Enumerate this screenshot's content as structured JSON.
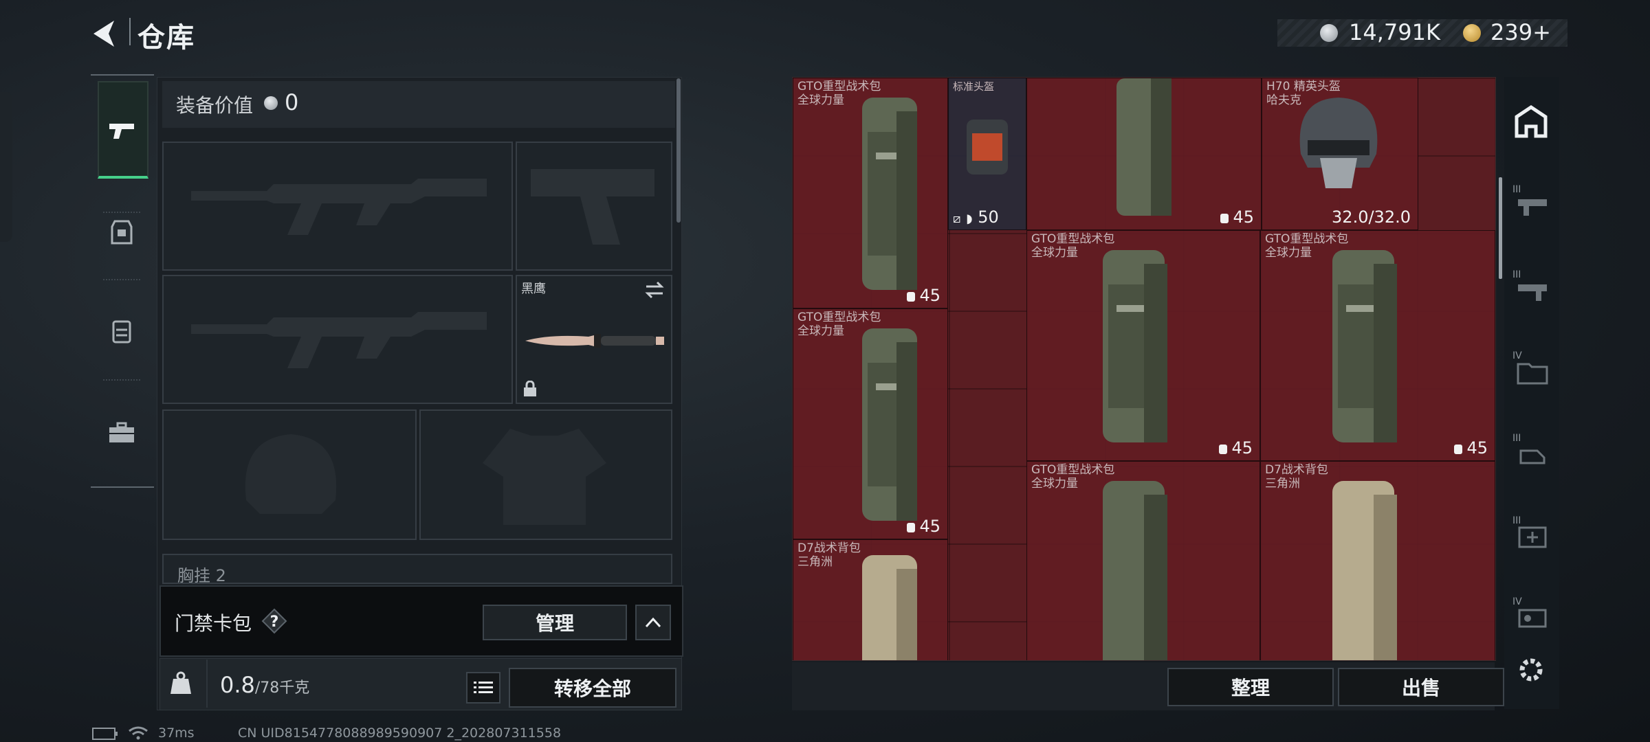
{
  "header": {
    "title": "仓库",
    "currency_silver": "14,791K",
    "currency_gold": "239+"
  },
  "equipment": {
    "title": "装备价值",
    "value": "0",
    "melee_name": "黑鹰",
    "chest_label_partial": "胸挂 2"
  },
  "access_card": {
    "label": "门禁卡包",
    "help": "?",
    "manage_label": "管理"
  },
  "weight": {
    "current": "0.8",
    "max": "/78千克",
    "transfer_all_label": "转移全部"
  },
  "stash": {
    "items": [
      {
        "name": "GTO重型战术包",
        "sub": "全球力量",
        "stat": "45"
      },
      {
        "name": "标准头盔",
        "sub": "",
        "durability": "50"
      },
      {
        "name": "",
        "sub": "",
        "stat": "45"
      },
      {
        "name": "H70 精英头盔",
        "sub": "哈夫克",
        "stat": "32.0/32.0"
      },
      {
        "name": "GTO重型战术包",
        "sub": "全球力量",
        "stat": "45"
      },
      {
        "name": "GTO重型战术包",
        "sub": "全球力量",
        "stat": "45"
      },
      {
        "name": "GTO重型战术包",
        "sub": "全球力量",
        "stat": "45"
      },
      {
        "name": "GTO重型战术包",
        "sub": "全球力量",
        "stat": ""
      },
      {
        "name": "D7战术背包",
        "sub": "三角洲",
        "stat": ""
      },
      {
        "name": "D7战术背包",
        "sub": "三角洲",
        "stat": ""
      }
    ],
    "sort_label": "整理",
    "sell_label": "出售"
  },
  "filters": {
    "tiers": [
      "III",
      "III",
      "IV",
      "III",
      "III",
      "IV"
    ]
  },
  "status_bar": {
    "ping": "37ms",
    "uid": "CN UID8154778088989590907 2_202807311558"
  },
  "colors": {
    "accent_green": "#45d08a",
    "stash_red": "#5a1d22"
  }
}
